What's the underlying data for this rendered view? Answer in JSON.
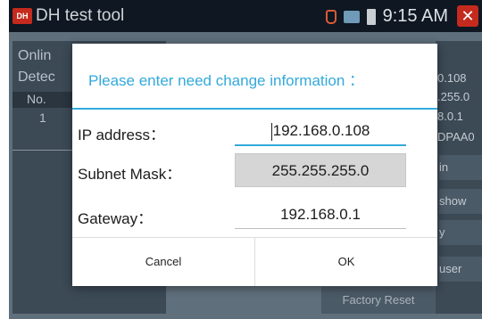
{
  "app": {
    "logo_text": "DH",
    "title": "DH test tool",
    "clock": "9:15 AM",
    "close_glyph": "✕"
  },
  "background": {
    "left_lines": [
      "Onlin",
      "Detec"
    ],
    "table_header": "No.",
    "row_number": "1",
    "right_values": [
      "0.108",
      ".255.0",
      "8.0.1",
      "DPAA0"
    ],
    "right_buttons": [
      "in",
      "show",
      "y",
      "user"
    ],
    "factory_reset": "Factory Reset"
  },
  "dialog": {
    "title": "Please enter need change information ：",
    "fields": {
      "ip_label": "IP address：",
      "ip_value": "192.168.0.108",
      "mask_label": "Subnet Mask：",
      "mask_value": "255.255.255.0",
      "gateway_label": "Gateway：",
      "gateway_value": "192.168.0.1"
    },
    "buttons": {
      "cancel": "Cancel",
      "ok": "OK"
    }
  },
  "colors": {
    "accent": "#33a9dc",
    "titlebar": "#0e1722",
    "app_red": "#c42a1d"
  }
}
